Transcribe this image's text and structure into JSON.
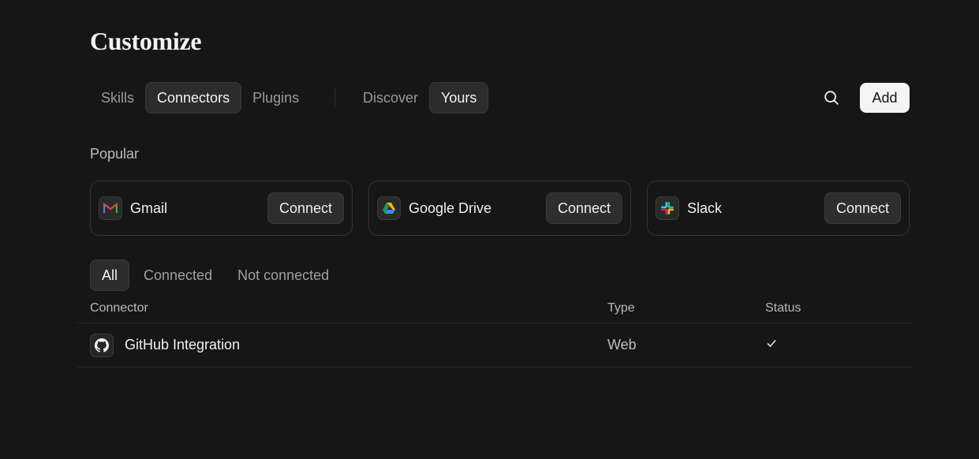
{
  "page": {
    "title": "Customize"
  },
  "tabs_primary": [
    {
      "label": "Skills",
      "active": false
    },
    {
      "label": "Connectors",
      "active": true
    },
    {
      "label": "Plugins",
      "active": false
    }
  ],
  "tabs_secondary": [
    {
      "label": "Discover",
      "active": false
    },
    {
      "label": "Yours",
      "active": true
    }
  ],
  "toolbar": {
    "search_icon": "search-icon",
    "add_label": "Add"
  },
  "popular": {
    "label": "Popular",
    "cards": [
      {
        "name": "Gmail",
        "icon": "gmail-icon",
        "action": "Connect"
      },
      {
        "name": "Google Drive",
        "icon": "google-drive-icon",
        "action": "Connect"
      },
      {
        "name": "Slack",
        "icon": "slack-icon",
        "action": "Connect"
      }
    ]
  },
  "filters": [
    {
      "label": "All",
      "active": true
    },
    {
      "label": "Connected",
      "active": false
    },
    {
      "label": "Not connected",
      "active": false
    }
  ],
  "table": {
    "headers": {
      "connector": "Connector",
      "type": "Type",
      "status": "Status"
    },
    "rows": [
      {
        "name": "GitHub Integration",
        "icon": "github-icon",
        "type": "Web",
        "status_icon": "check-icon"
      }
    ]
  },
  "colors": {
    "background": "#161616",
    "active_tab": "#2c2c2c",
    "add_button": "#f5f5f5"
  }
}
